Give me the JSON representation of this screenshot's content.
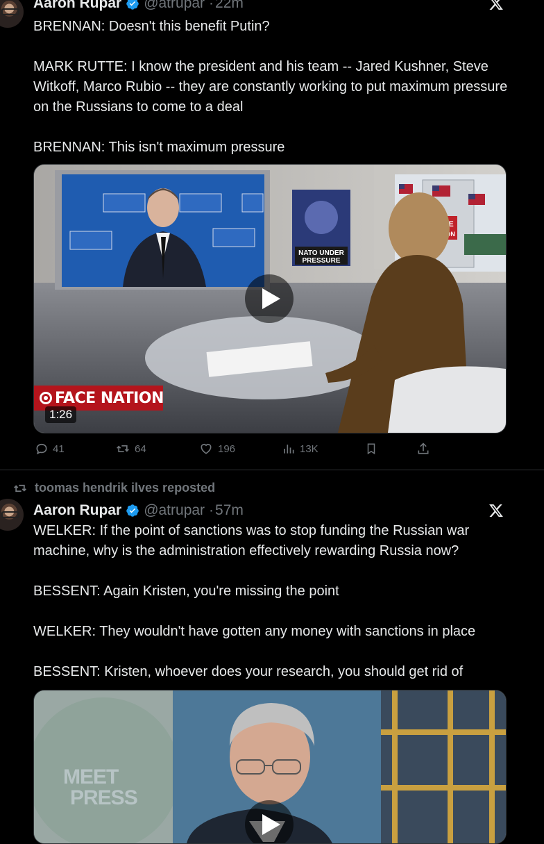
{
  "tweets": [
    {
      "author": "Aaron Rupar",
      "handle": "@atrupar",
      "time": "22m",
      "paragraphs": [
        "BRENNAN: Doesn't this benefit Putin?",
        "MARK RUTTE: I know the president and his team -- Jared Kushner, Steve Witkoff, Marco Rubio -- they are constantly working to put maximum pressure on the Russians to come to a deal",
        "BRENNAN: This isn't maximum pressure"
      ],
      "video": {
        "duration": "1:26",
        "logo": "FACE NATION",
        "chyron": "NATO UNDER PRESSURE",
        "screen_logo": "FACE THE NATION",
        "flag_text": "NATO OTAN"
      },
      "stats": {
        "replies": "41",
        "reposts": "64",
        "likes": "196",
        "views": "13K"
      }
    },
    {
      "reposted_by": "toomas hendrik ilves reposted",
      "author": "Aaron Rupar",
      "handle": "@atrupar",
      "time": "57m",
      "paragraphs": [
        "WELKER: If the point of sanctions was to stop funding the Russian war machine, why is the administration effectively rewarding Russia now?",
        "BESSENT: Again Kristen, you're missing the point",
        "WELKER: They wouldn't have gotten any money with sanctions in place",
        "BESSENT: Kristen, whoever does your research, you should get rid of"
      ],
      "video": {
        "logo_line1": "MEET",
        "logo_line2": "PRESS"
      }
    }
  ],
  "colors": {
    "background": "#000000",
    "text": "#e7e9ea",
    "muted": "#71767b",
    "verified": "#1d9bf0",
    "divider": "#2f3336"
  }
}
